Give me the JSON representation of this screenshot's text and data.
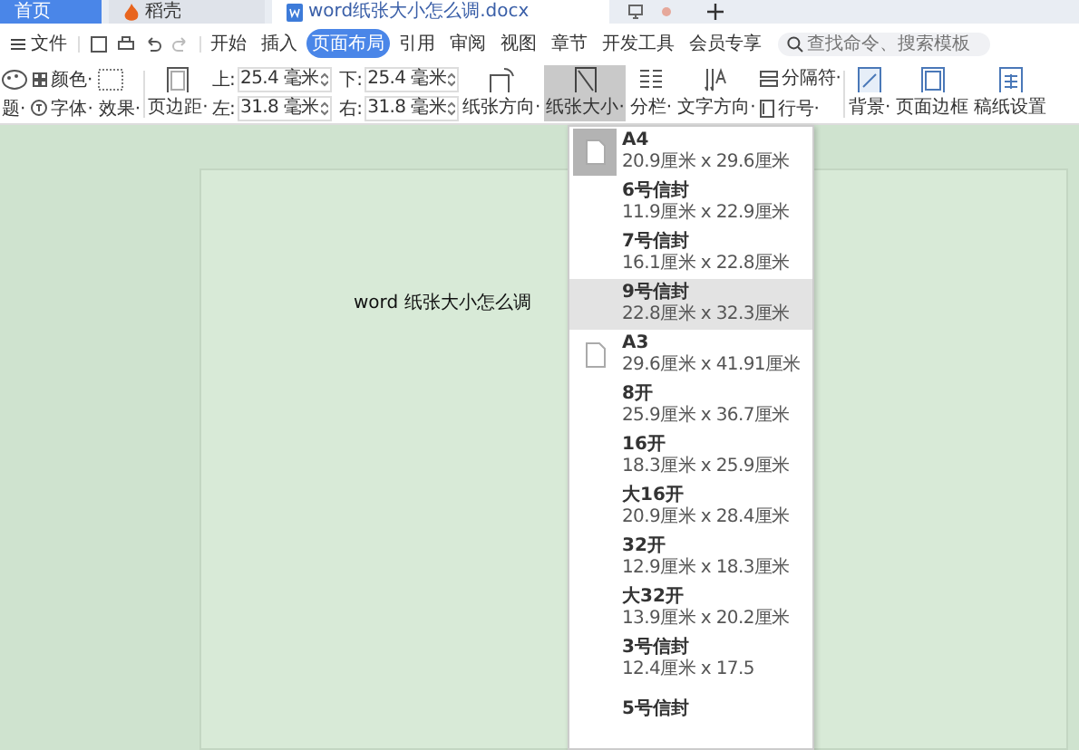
{
  "tabs": [
    {
      "label": "首页",
      "kind": "home",
      "selected": false
    },
    {
      "label": "稻壳",
      "kind": "docer",
      "selected": false
    },
    {
      "label": "word纸张大小怎么调.docx",
      "kind": "doc",
      "selected": true
    }
  ],
  "menu": {
    "file": "文件",
    "tabs": [
      {
        "label": "开始",
        "selected": false
      },
      {
        "label": "插入",
        "selected": false
      },
      {
        "label": "页面布局",
        "selected": true
      },
      {
        "label": "引用",
        "selected": false
      },
      {
        "label": "审阅",
        "selected": false
      },
      {
        "label": "视图",
        "selected": false
      },
      {
        "label": "章节",
        "selected": false
      },
      {
        "label": "开发工具",
        "selected": false
      },
      {
        "label": "会员专享",
        "selected": false
      }
    ],
    "search": {
      "placeholder": "查找命令、搜索模板"
    }
  },
  "ribbon": {
    "theme": "题·",
    "colors_label": "颜色·",
    "font": "字体·",
    "effect": "效果·",
    "margins": "页边距·",
    "margin_fields": [
      {
        "label": "上:",
        "value": "25.4 毫米"
      },
      {
        "label": "下:",
        "value": "25.4 毫米"
      },
      {
        "label": "左:",
        "value": "31.8 毫米"
      },
      {
        "label": "右:",
        "value": "31.8 毫米"
      }
    ],
    "tools": [
      {
        "label": "纸张方向·",
        "kind": "orientation",
        "selected": false
      },
      {
        "label": "纸张大小·",
        "kind": "size",
        "selected": true
      },
      {
        "label": "分栏·",
        "kind": "columns",
        "selected": false
      },
      {
        "label": "文字方向·",
        "kind": "text-dir",
        "selected": false
      }
    ],
    "small_tools": [
      {
        "label": "分隔符·",
        "kind": "break"
      },
      {
        "label": "行号·",
        "kind": "lines"
      }
    ],
    "tools2": [
      {
        "label": "背景·",
        "kind": "background"
      },
      {
        "label": "页面边框",
        "kind": "border"
      },
      {
        "label": "稿纸设置",
        "kind": "grid"
      }
    ]
  },
  "document": {
    "text": "word 纸张大小怎么调"
  },
  "paper_sizes": [
    {
      "name": "A4",
      "size": "20.9厘米 x 29.6厘米",
      "has_icon": true,
      "current": true,
      "selected": false
    },
    {
      "name": "6号信封",
      "size": "11.9厘米 x 22.9厘米",
      "has_icon": false,
      "current": false,
      "selected": false
    },
    {
      "name": "7号信封",
      "size": "16.1厘米 x 22.8厘米",
      "has_icon": false,
      "current": false,
      "selected": false
    },
    {
      "name": "9号信封",
      "size": "22.8厘米 x 32.3厘米",
      "has_icon": false,
      "current": false,
      "selected": true
    },
    {
      "name": "A3",
      "size": "29.6厘米 x 41.91厘米",
      "has_icon": true,
      "current": false,
      "selected": false
    },
    {
      "name": "8开",
      "size": "25.9厘米 x 36.7厘米",
      "has_icon": false,
      "current": false,
      "selected": false
    },
    {
      "name": "16开",
      "size": "18.3厘米 x 25.9厘米",
      "has_icon": false,
      "current": false,
      "selected": false
    },
    {
      "name": "大16开",
      "size": "20.9厘米 x 28.4厘米",
      "has_icon": false,
      "current": false,
      "selected": false
    },
    {
      "name": "32开",
      "size": "12.9厘米 x 18.3厘米",
      "has_icon": false,
      "current": false,
      "selected": false
    },
    {
      "name": "大32开",
      "size": "13.9厘米 x 20.2厘米",
      "has_icon": false,
      "current": false,
      "selected": false
    },
    {
      "name": "3号信封",
      "size": "12.4厘米 x 17.5",
      "has_icon": false,
      "current": false,
      "selected": false
    },
    {
      "name": "5号信封",
      "has_icon": false,
      "current": false,
      "selected": false
    }
  ]
}
